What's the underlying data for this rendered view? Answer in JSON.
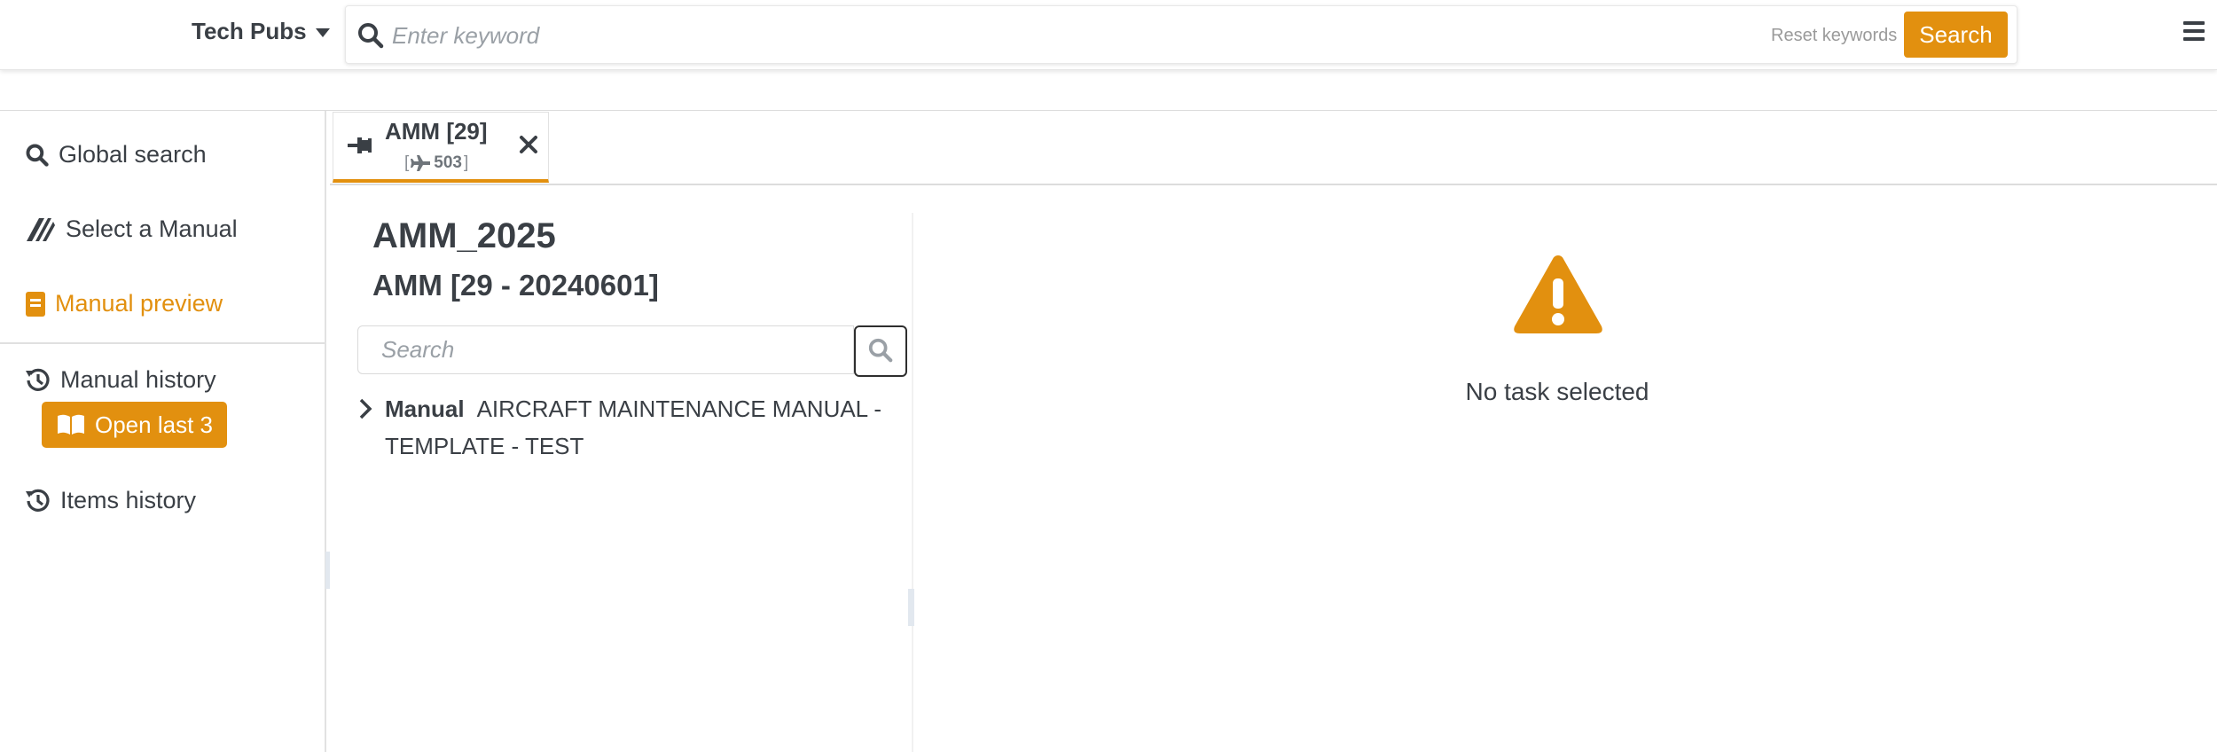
{
  "header": {
    "brand": "Tech Pubs",
    "search_placeholder": "Enter keyword",
    "reset_label": "Reset keywords",
    "search_button": "Search",
    "menu_icon": "hamburger-menu-icon"
  },
  "sidebar": {
    "items": [
      {
        "label": "Global search",
        "icon": "search-icon"
      },
      {
        "label": "Select a Manual",
        "icon": "manual-select-icon"
      },
      {
        "label": "Manual preview",
        "icon": "book-icon",
        "active": true
      },
      {
        "label": "Manual history",
        "icon": "history-icon"
      },
      {
        "label": "Items history",
        "icon": "history-icon"
      }
    ],
    "open_last_label": "Open last 3"
  },
  "tab": {
    "label": "AMM [29]",
    "sub_prefix": "[",
    "sub_value": "503",
    "sub_suffix": "]"
  },
  "tree": {
    "title": "AMM_2025",
    "subtitle": "AMM [29 - 20240601]",
    "search_placeholder": "Search",
    "nodes": [
      {
        "type": "Manual",
        "label": "AIRCRAFT MAINTENANCE MANUAL - TEMPLATE - TEST"
      }
    ]
  },
  "content": {
    "empty_message": "No task selected"
  },
  "colors": {
    "accent": "#e2900f",
    "text": "#3a3f45",
    "muted": "#9aa0a6"
  }
}
